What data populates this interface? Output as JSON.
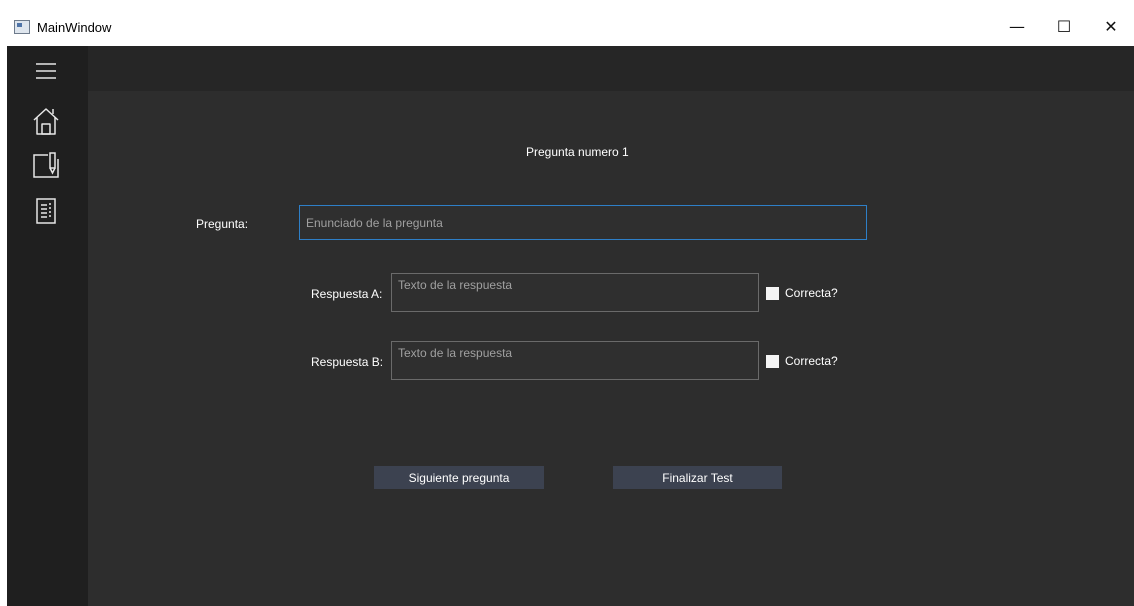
{
  "window": {
    "title": "MainWindow",
    "minimize_glyph": "—",
    "maximize_glyph": "☐",
    "close_glyph": "✕"
  },
  "sidebar": {
    "items": [
      {
        "icon": "menu-icon"
      },
      {
        "icon": "home-icon"
      },
      {
        "icon": "notebook-pen-icon"
      },
      {
        "icon": "document-list-icon"
      }
    ]
  },
  "form": {
    "heading": "Pregunta numero 1",
    "question_label": "Pregunta:",
    "question_placeholder": "Enunciado de la pregunta",
    "answers": [
      {
        "label": "Respuesta A:",
        "placeholder": "Texto de la respuesta",
        "correct_label": "Correcta?",
        "checked": false
      },
      {
        "label": "Respuesta B:",
        "placeholder": "Texto de la respuesta",
        "correct_label": "Correcta?",
        "checked": false
      }
    ],
    "next_button": "Siguiente pregunta",
    "finish_button": "Finalizar Test"
  },
  "colors": {
    "background": "#2d2d2d",
    "sidebar": "#1f1f1f",
    "focus_border": "#2e7fc7",
    "button": "#3c4250"
  }
}
